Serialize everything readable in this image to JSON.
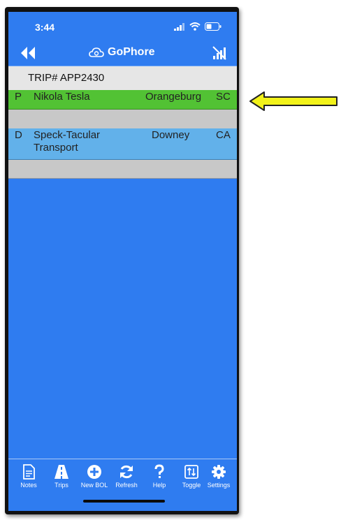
{
  "status_bar": {
    "time": "3:44"
  },
  "navbar": {
    "brand": "GoPhore"
  },
  "trip": {
    "header": "TRIP# APP2430"
  },
  "stops": [
    {
      "type": "P",
      "name": "Nikola Tesla",
      "city": "Orangeburg",
      "state": "SC",
      "color": "#52c234"
    },
    {
      "type": "D",
      "name": "Speck-Tacular Transport",
      "city": "Downey",
      "state": "CA",
      "color": "#62b1ea"
    }
  ],
  "tabs": [
    {
      "label": "Notes",
      "icon": "notes-icon"
    },
    {
      "label": "Trips",
      "icon": "road-icon"
    },
    {
      "label": "New BOL",
      "icon": "plus-circle-icon"
    },
    {
      "label": "Refresh",
      "icon": "refresh-icon"
    },
    {
      "label": "Help",
      "icon": "question-icon"
    },
    {
      "label": "Toggle",
      "icon": "toggle-icon"
    },
    {
      "label": "Settings",
      "icon": "gear-icon"
    }
  ],
  "colors": {
    "screen_bg": "#2f7cf0",
    "header_bg": "#e6e6e6",
    "separator": "#c8c8c8",
    "arrow": "#f2f21a"
  }
}
